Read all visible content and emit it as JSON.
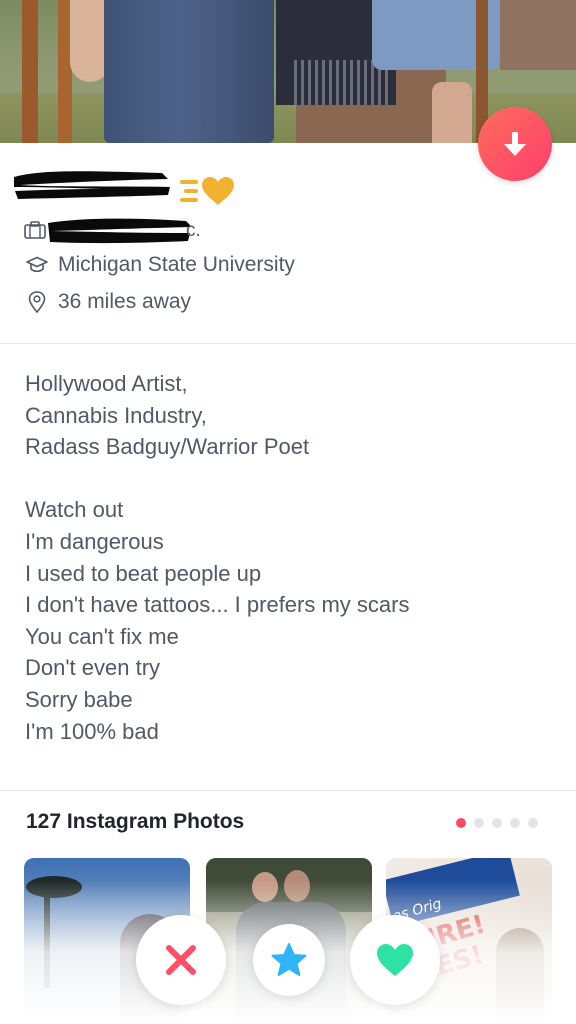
{
  "profile": {
    "school": "Michigan State University",
    "distance": "36 miles away",
    "job_suffix": "c."
  },
  "bio": {
    "lines": [
      "Hollywood Artist,",
      "Cannabis Industry,",
      "Radass Badguy/Warrior Poet",
      "",
      "Watch out",
      "I'm dangerous",
      "I used to beat people up",
      "I don't have tattoos... I prefers my scars",
      "You can't fix me",
      "Don't even try",
      "Sorry babe",
      "I'm 100% bad"
    ]
  },
  "instagram": {
    "title": "127 Instagram Photos",
    "page_count": 5,
    "active_page": 1,
    "thumb3_sign_text": "as Orig URE! LES!"
  },
  "icons": {
    "scroll_down": "arrow-down-icon",
    "super_like_badge": "speed-heart-icon",
    "job": "briefcase-icon",
    "school": "graduation-cap-icon",
    "location": "location-pin-icon",
    "nope": "x-icon",
    "super_like": "star-icon",
    "like": "heart-icon"
  },
  "colors": {
    "brand_gradient_start": "#ff6d5a",
    "brand_gradient_end": "#fd3d6e",
    "nope": "#fd5068",
    "super_like": "#2db4f9",
    "like": "#2ee2a4",
    "badge_gold": "#f2b230",
    "text": "#505965"
  }
}
